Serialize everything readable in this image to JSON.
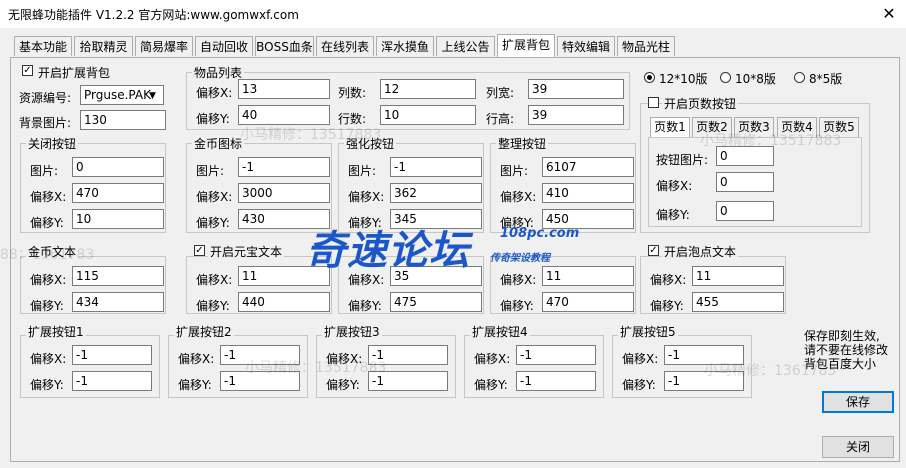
{
  "window": {
    "title": "无限蜂功能插件 V1.2.2  官方网站:www.gomwxf.com",
    "close_glyph": "✕"
  },
  "tabs": [
    "基本功能",
    "拾取精灵",
    "简易爆率",
    "自动回收",
    "BOSS血条",
    "在线列表",
    "浑水摸鱼",
    "上线公告",
    "扩展背包",
    "特效编辑",
    "物品光柱"
  ],
  "active_tab": "扩展背包",
  "enable_bag": {
    "label": "开启扩展背包",
    "checked": true
  },
  "resource": {
    "label": "资源编号:",
    "value": "Prguse.PAK"
  },
  "bg_image": {
    "label": "背景图片:",
    "value": "130"
  },
  "item_list": {
    "title": "物品列表",
    "offset_x": {
      "label": "偏移X:",
      "value": "13"
    },
    "offset_y": {
      "label": "偏移Y:",
      "value": "40"
    },
    "cols": {
      "label": "列数:",
      "value": "12"
    },
    "rows": {
      "label": "行数:",
      "value": "10"
    },
    "col_width": {
      "label": "列宽:",
      "value": "39"
    },
    "row_height": {
      "label": "行高:",
      "value": "39"
    }
  },
  "layout_options": {
    "items": [
      "12*10版",
      "10*8版",
      "8*5版"
    ],
    "selected": "12*10版"
  },
  "page_buttons": {
    "label": "开启页数按钮",
    "checked": false,
    "tabs": [
      "页数1",
      "页数2",
      "页数3",
      "页数4",
      "页数5"
    ],
    "active": "页数1",
    "image": {
      "label": "按钮图片:",
      "value": "0"
    },
    "offset_x": {
      "label": "偏移X:",
      "value": "0"
    },
    "offset_y": {
      "label": "偏移Y:",
      "value": "0"
    }
  },
  "image_groups": [
    {
      "title": "关闭按钮",
      "image": "0",
      "x": "470",
      "y": "10"
    },
    {
      "title": "金币图标",
      "image": "-1",
      "x": "3000",
      "y": "430"
    },
    {
      "title": "强化按钮",
      "image": "-1",
      "x": "362",
      "y": "345"
    },
    {
      "title": "整理按钮",
      "image": "6107",
      "x": "410",
      "y": "450"
    }
  ],
  "labels": {
    "image": "图片:",
    "offset_x": "偏移X:",
    "offset_y": "偏移Y:"
  },
  "text_groups": [
    {
      "title": "金币文本",
      "has_check": false,
      "x": "115",
      "y": "434"
    },
    {
      "title": "开启元宝文本",
      "has_check": true,
      "checked": true,
      "x": "11",
      "y": "440"
    },
    {
      "title": "",
      "has_check": false,
      "x": "35",
      "y": "475"
    },
    {
      "title": "",
      "has_check": false,
      "x": "11",
      "y": "470"
    },
    {
      "title": "开启泡点文本",
      "has_check": true,
      "checked": true,
      "x": "11",
      "y": "455"
    }
  ],
  "ext_buttons": [
    {
      "title": "扩展按钮1",
      "x": "-1",
      "y": "-1"
    },
    {
      "title": "扩展按钮2",
      "x": "-1",
      "y": "-1"
    },
    {
      "title": "扩展按钮3",
      "x": "-1",
      "y": "-1"
    },
    {
      "title": "扩展按钮4",
      "x": "-1",
      "y": "-1"
    },
    {
      "title": "扩展按钮5",
      "x": "-1",
      "y": "-1"
    }
  ],
  "note": {
    "line1": "保存即刻生效,",
    "line2": "请不要在线修改",
    "line3": "背包百度大小"
  },
  "save_label": "保存",
  "close_label": "关闭",
  "watermarks": [
    "小马精修：13517883",
    "88：1361783",
    "小马精修：13517883",
    "小马精修：13517883",
    "小马精修：1361783"
  ],
  "logo": {
    "main": "奇速论坛",
    "domain": "108pc.com",
    "tagline": "传奇架设教程"
  }
}
